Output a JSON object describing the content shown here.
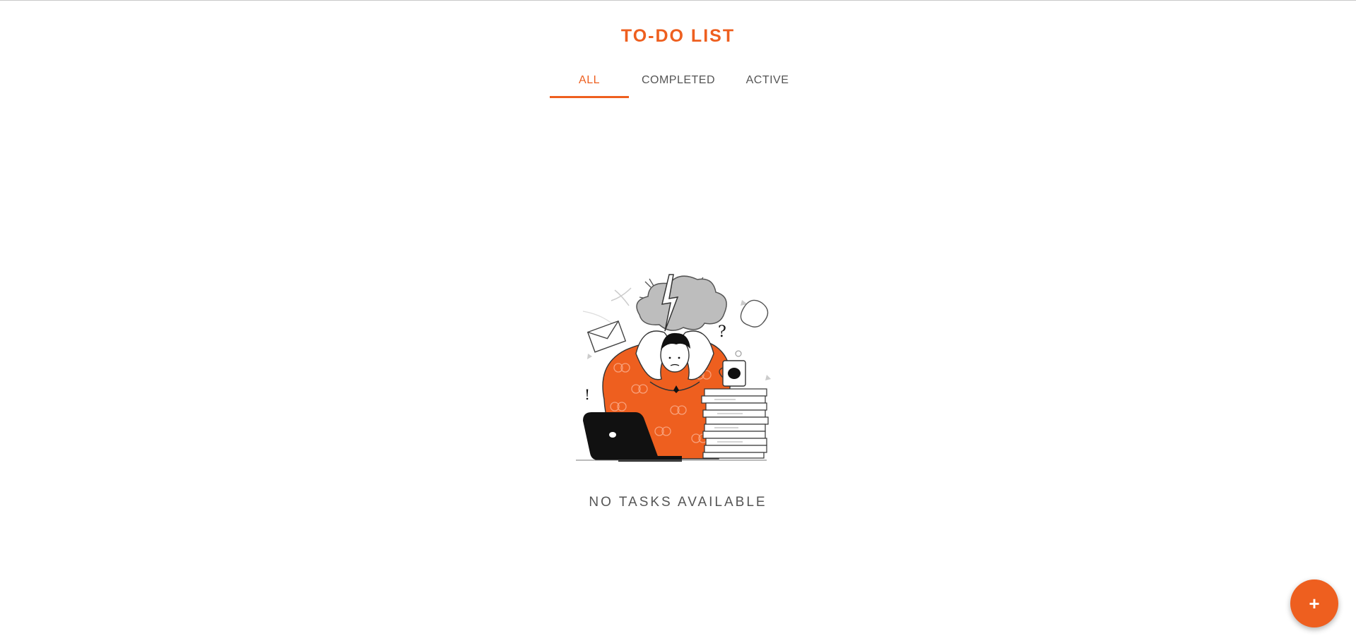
{
  "app": {
    "title": "TO-DO LIST"
  },
  "tabs": [
    {
      "label": "ALL",
      "active": true
    },
    {
      "label": "COMPLETED",
      "active": false
    },
    {
      "label": "ACTIVE",
      "active": false
    }
  ],
  "empty_state": {
    "message": "NO TASKS AVAILABLE",
    "illustration": "stressed-person-at-desk-illustration"
  },
  "fab": {
    "label": "+",
    "icon": "plus-icon"
  },
  "colors": {
    "accent": "#ee5f1f",
    "text_muted": "#555555",
    "background": "#ffffff"
  }
}
